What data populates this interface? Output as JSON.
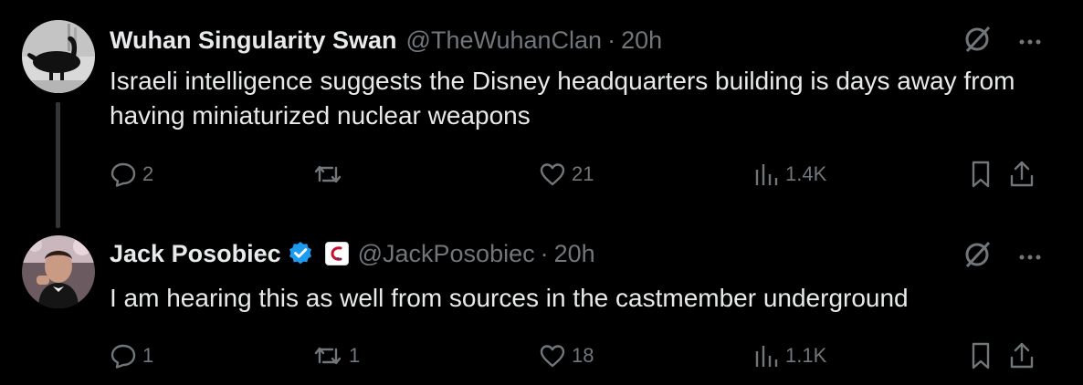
{
  "tweets": [
    {
      "name": "Wuhan Singularity Swan",
      "handle": "@TheWuhanClan",
      "separator": "·",
      "time": "20h",
      "text": "Israeli intelligence suggests the Disney headquarters building is days away from having miniaturized nuclear weapons",
      "replies": "2",
      "retweets": "",
      "likes": "21",
      "views": "1.4K"
    },
    {
      "name": "Jack Posobiec",
      "handle": "@JackPosobiec",
      "separator": "·",
      "time": "20h",
      "verified": true,
      "text": "I am hearing this as well from sources in the castmember underground",
      "replies": "1",
      "retweets": "1",
      "likes": "18",
      "views": "1.1K"
    }
  ],
  "colors": {
    "background": "#000000",
    "text": "#e7e9ea",
    "secondary": "#71767b",
    "verified": "#1d9bf0",
    "thread_line": "#333639"
  },
  "icons": [
    "reply-icon",
    "retweet-icon",
    "like-icon",
    "views-icon",
    "bookmark-icon",
    "share-icon",
    "grok-icon",
    "more-icon",
    "verified-badge-icon",
    "affiliate-badge-icon"
  ]
}
